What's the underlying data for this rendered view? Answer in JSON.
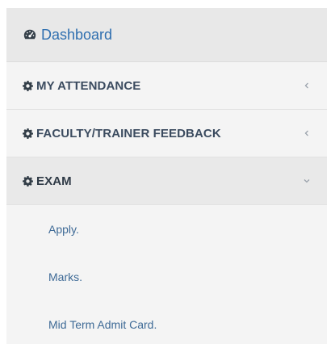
{
  "dashboard": {
    "label": "Dashboard",
    "icon": "tachometer-icon"
  },
  "menu": [
    {
      "label": "MY ATTENDANCE",
      "icon": "gear-icon",
      "chevron": "chevron-left-icon",
      "expanded": false
    },
    {
      "label": "FACULTY/TRAINER FEEDBACK",
      "icon": "gear-icon",
      "chevron": "chevron-left-icon",
      "expanded": false
    },
    {
      "label": "EXAM",
      "icon": "gear-icon",
      "chevron": "chevron-down-icon",
      "expanded": true
    }
  ],
  "exam_submenu": [
    {
      "label": "Apply."
    },
    {
      "label": "Marks."
    },
    {
      "label": "Mid Term Admit Card."
    }
  ],
  "colors": {
    "link_blue": "#2f6fb0",
    "menu_text": "#3b4b5f",
    "sidebar_bg": "#f4f4f4",
    "header_bg": "#e8e8e8"
  }
}
